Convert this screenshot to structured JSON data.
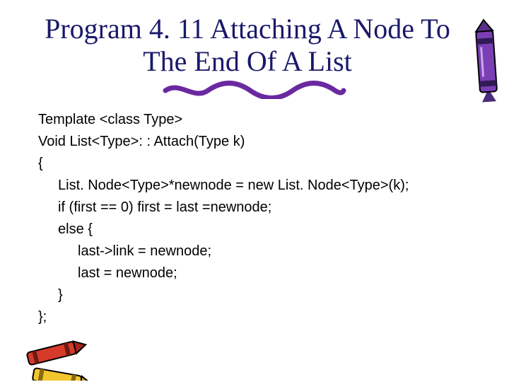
{
  "title": "Program 4. 11 Attaching A Node To The End Of A List",
  "code": {
    "l0": "Template <class Type>",
    "l1": "Void List<Type>: : Attach(Type k)",
    "l2": "{",
    "l3": "List. Node<Type>*newnode = new List. Node<Type>(k);",
    "l4": "if (first == 0) first = last =newnode;",
    "l5": "else {",
    "l6": "last->link = newnode;",
    "l7": "last = newnode;",
    "l8": "}",
    "l9": "};"
  },
  "crayons": {
    "top_right": "crayon-purple",
    "bottom_left": "crayons-red-yellow"
  }
}
